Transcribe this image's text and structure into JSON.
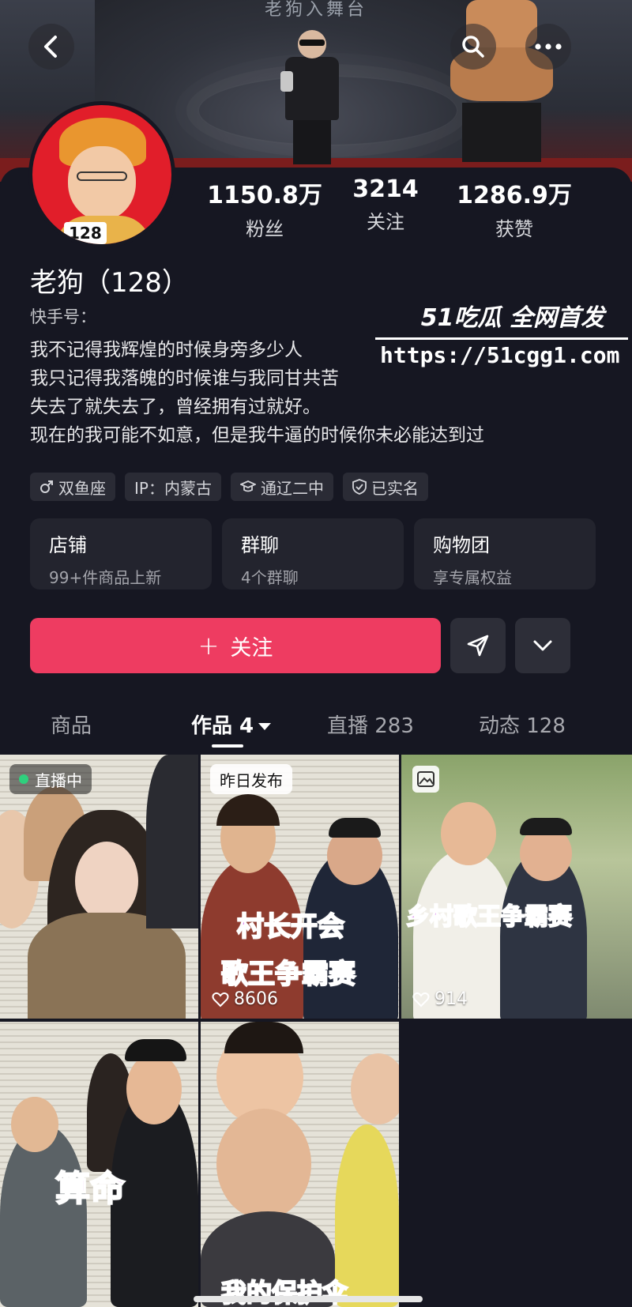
{
  "header": {
    "stage_text": "老狗入舞台",
    "back_icon": "chevron-left-icon",
    "search_icon": "search-icon",
    "more_icon": "more-dots-icon"
  },
  "profile": {
    "avatar_number": "128",
    "name": "老狗（128）",
    "id_label": "快手号：",
    "bio": [
      "我不记得我辉煌的时候身旁多少人",
      "我只记得我落魄的时候谁与我同甘共苦",
      "失去了就失去了，曾经拥有过就好。",
      "现在的我可能不如意，但是我牛逼的时候你未必能达到过"
    ],
    "stats": [
      {
        "value": "1150.8万",
        "label": "粉丝"
      },
      {
        "value": "3214",
        "label": "关注"
      },
      {
        "value": "1286.9万",
        "label": "获赞"
      }
    ],
    "tags": [
      {
        "icon": "male-icon",
        "label": "双鱼座"
      },
      {
        "icon": "",
        "label": "IP：内蒙古"
      },
      {
        "icon": "school-icon",
        "label": "通辽二中"
      },
      {
        "icon": "verified-shield-icon",
        "label": "已实名"
      }
    ],
    "tiles": [
      {
        "title": "店铺",
        "subtitle": "99+件商品上新"
      },
      {
        "title": "群聊",
        "subtitle": "4个群聊"
      },
      {
        "title": "购物团",
        "subtitle": "享专属权益"
      }
    ]
  },
  "watermark": {
    "top": "51吃瓜 全网首发",
    "url": "https://51cgg1.com"
  },
  "actions": {
    "follow_label": "关注",
    "share_icon": "send-icon",
    "dropdown_icon": "chevron-down-icon"
  },
  "tabs": [
    {
      "label": "商品",
      "active": false
    },
    {
      "label": "作品 4",
      "active": true
    },
    {
      "label": "直播 283",
      "active": false
    },
    {
      "label": "动态 128",
      "active": false
    }
  ],
  "videos": [
    {
      "badge": "直播中",
      "caption": "",
      "likes": ""
    },
    {
      "badge": "昨日发布",
      "caption": "村长开会",
      "caption2": "歌王争霸赛",
      "likes": "8606"
    },
    {
      "badge": "",
      "caption": "乡村歌王争霸赛",
      "likes": "914"
    },
    {
      "badge": "",
      "caption": "算命",
      "likes": ""
    },
    {
      "badge": "",
      "caption": "我的保护伞",
      "likes": ""
    }
  ],
  "colors": {
    "background": "#161722",
    "accent": "#ee3c61",
    "tile": "#23242e",
    "caption": "#c847e6"
  }
}
